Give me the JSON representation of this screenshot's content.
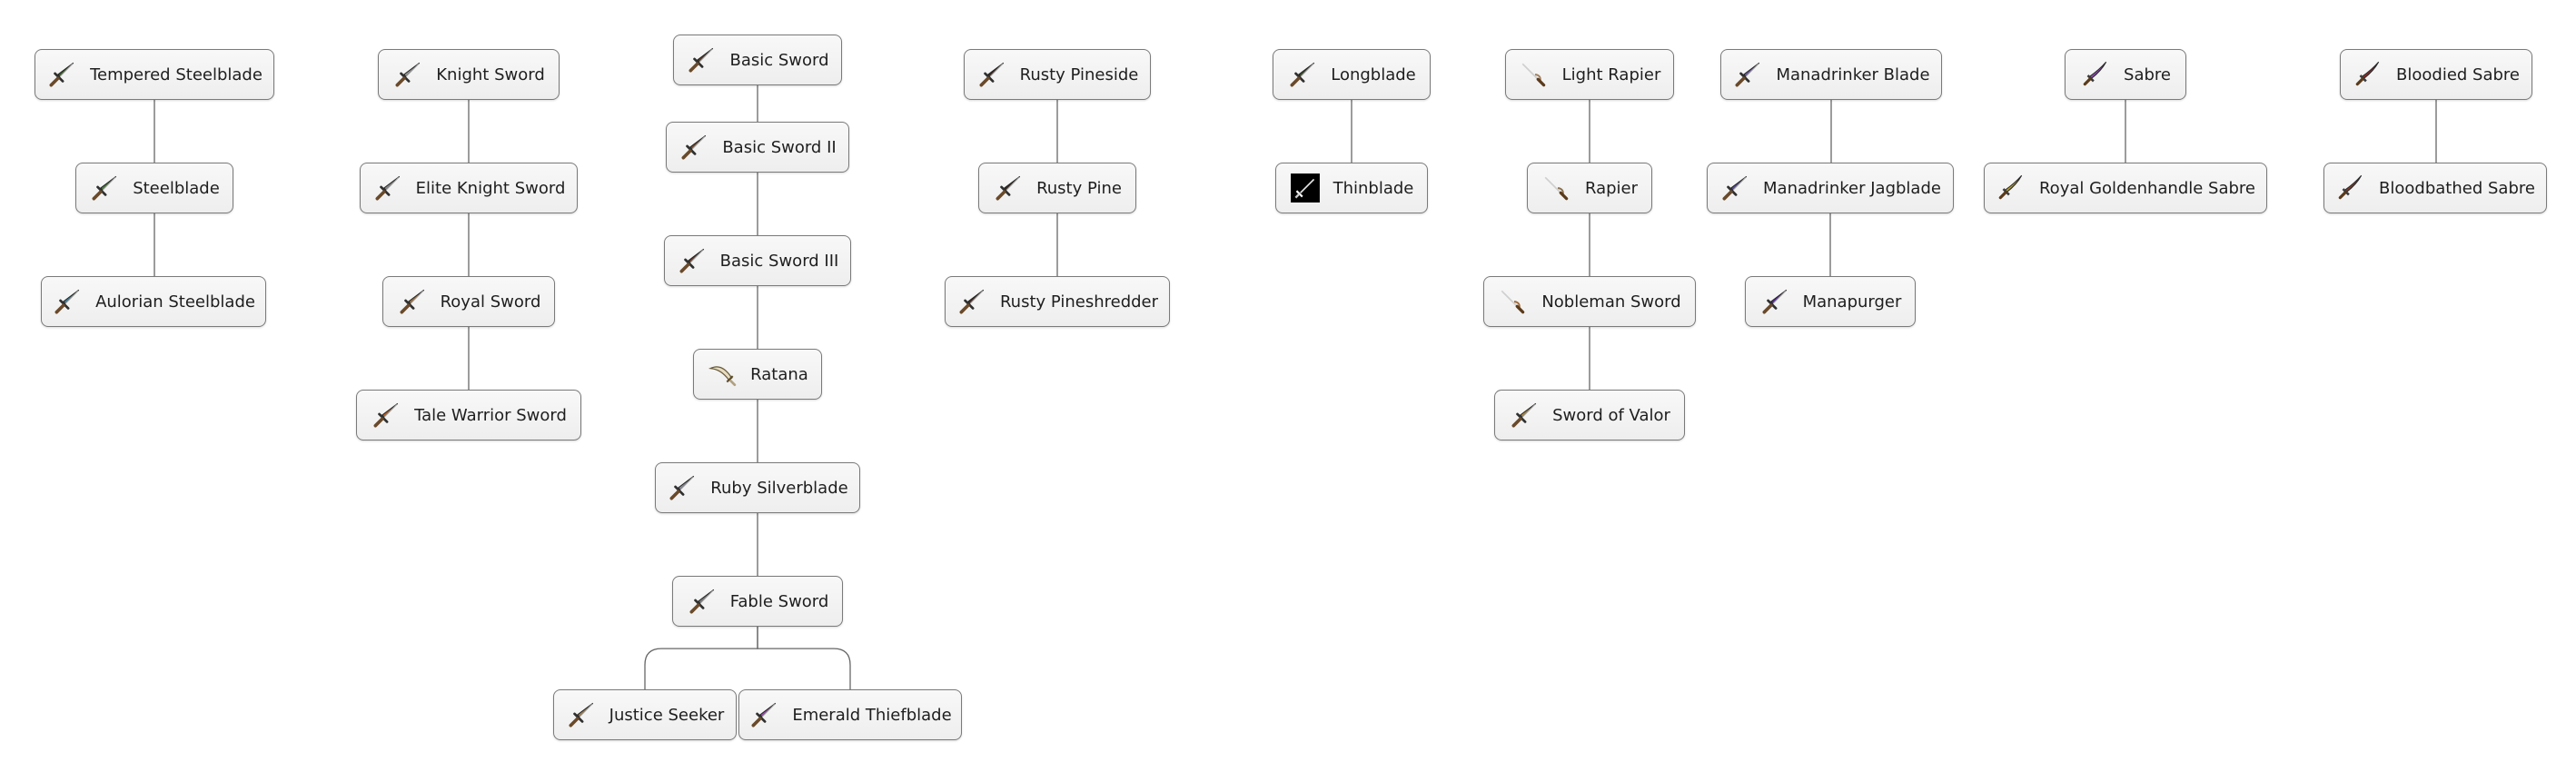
{
  "trees": [
    {
      "nodes": [
        {
          "id": "tempered-steelblade",
          "label": "Tempered Steelblade",
          "icon": "sword-icon",
          "color": "#3a5a2a",
          "parent": null
        },
        {
          "id": "steelblade",
          "label": "Steelblade",
          "icon": "sword-icon",
          "color": "#4a7a3a",
          "parent": "tempered-steelblade"
        },
        {
          "id": "aulorian-steelblade",
          "label": "Aulorian Steelblade",
          "icon": "sword-icon",
          "color": "#3f7f9a",
          "parent": "steelblade"
        }
      ]
    },
    {
      "nodes": [
        {
          "id": "knight-sword",
          "label": "Knight Sword",
          "icon": "sword-icon",
          "color": "#9a9a9a",
          "parent": null
        },
        {
          "id": "elite-knight-sword",
          "label": "Elite Knight Sword",
          "icon": "sword-icon",
          "color": "#8a8a8a",
          "parent": "knight-sword"
        },
        {
          "id": "royal-sword",
          "label": "Royal Sword",
          "icon": "sword-icon",
          "color": "#a0703a",
          "parent": "elite-knight-sword"
        },
        {
          "id": "tale-warrior-sword",
          "label": "Tale Warrior Sword",
          "icon": "sword-icon",
          "color": "#c0601a",
          "parent": "royal-sword"
        }
      ]
    },
    {
      "nodes": [
        {
          "id": "basic-sword",
          "label": "Basic Sword",
          "icon": "sword-icon",
          "color": "#5a3a2a",
          "parent": null
        },
        {
          "id": "basic-sword-ii",
          "label": "Basic Sword II",
          "icon": "sword-icon",
          "color": "#7a4a2a",
          "parent": "basic-sword"
        },
        {
          "id": "basic-sword-iii",
          "label": "Basic Sword III",
          "icon": "sword-icon",
          "color": "#6a3a2a",
          "parent": "basic-sword-ii"
        },
        {
          "id": "ratana",
          "label": "Ratana",
          "icon": "scimitar-icon",
          "color": "#b0a080",
          "parent": "basic-sword-iii"
        },
        {
          "id": "ruby-silverblade",
          "label": "Ruby Silverblade",
          "icon": "sword-icon",
          "color": "#8a8a9a",
          "parent": "ratana"
        },
        {
          "id": "fable-sword",
          "label": "Fable Sword",
          "icon": "sword-icon",
          "color": "#7a7a7a",
          "parent": "ruby-silverblade"
        },
        {
          "id": "justice-seeker",
          "label": "Justice Seeker",
          "icon": "sword-icon",
          "color": "#a08050",
          "parent": "fable-sword"
        },
        {
          "id": "emerald-thiefblade",
          "label": "Emerald Thiefblade",
          "icon": "sword-icon",
          "color": "#9a4aaa",
          "parent": "fable-sword"
        }
      ]
    },
    {
      "nodes": [
        {
          "id": "rusty-pineside",
          "label": "Rusty Pineside",
          "icon": "sword-icon",
          "color": "#3a2a22",
          "parent": null
        },
        {
          "id": "rusty-pine",
          "label": "Rusty Pine",
          "icon": "sword-icon",
          "color": "#3a2a22",
          "parent": "rusty-pineside"
        },
        {
          "id": "rusty-pineshredder",
          "label": "Rusty Pineshredder",
          "icon": "sword-icon",
          "color": "#4a2a22",
          "parent": "rusty-pine"
        }
      ]
    },
    {
      "nodes": [
        {
          "id": "longblade",
          "label": "Longblade",
          "icon": "sword-icon",
          "color": "#3a4a2a",
          "parent": null
        },
        {
          "id": "thinblade",
          "label": "Thinblade",
          "icon": "thin-sword-icon",
          "color": "#000000",
          "parent": "longblade"
        }
      ]
    },
    {
      "nodes": [
        {
          "id": "light-rapier",
          "label": "Light Rapier",
          "icon": "rapier-icon",
          "color": "#a08060",
          "parent": null
        },
        {
          "id": "rapier",
          "label": "Rapier",
          "icon": "rapier-icon",
          "color": "#8a7050",
          "parent": "light-rapier"
        },
        {
          "id": "nobleman-sword",
          "label": "Nobleman Sword",
          "icon": "rapier-icon",
          "color": "#a06a3a",
          "parent": "rapier"
        },
        {
          "id": "sword-of-valor",
          "label": "Sword of Valor",
          "icon": "sword-icon",
          "color": "#b08a3a",
          "parent": "nobleman-sword"
        }
      ]
    },
    {
      "nodes": [
        {
          "id": "manadrinker-blade",
          "label": "Manadrinker Blade",
          "icon": "sword-icon",
          "color": "#6a5aa0",
          "parent": null
        },
        {
          "id": "manadrinker-jagblade",
          "label": "Manadrinker Jagblade",
          "icon": "sword-icon",
          "color": "#5a4a9a",
          "parent": "manadrinker-blade"
        },
        {
          "id": "manapurger",
          "label": "Manapurger",
          "icon": "sword-icon",
          "color": "#5a2a9a",
          "parent": "manadrinker-jagblade"
        }
      ]
    },
    {
      "nodes": [
        {
          "id": "sabre",
          "label": "Sabre",
          "icon": "sabre-icon",
          "color": "#8a4aaa",
          "parent": null
        },
        {
          "id": "royal-goldenhandle-sabre",
          "label": "Royal Goldenhandle Sabre",
          "icon": "sabre-icon",
          "color": "#b09a2a",
          "parent": "sabre"
        }
      ]
    },
    {
      "nodes": [
        {
          "id": "bloodied-sabre",
          "label": "Bloodied Sabre",
          "icon": "sabre-icon",
          "color": "#8a2a2a",
          "parent": null
        },
        {
          "id": "bloodbathed-sabre",
          "label": "Bloodbathed Sabre",
          "icon": "sabre-icon",
          "color": "#7a3a2a",
          "parent": "bloodied-sabre"
        }
      ]
    }
  ]
}
